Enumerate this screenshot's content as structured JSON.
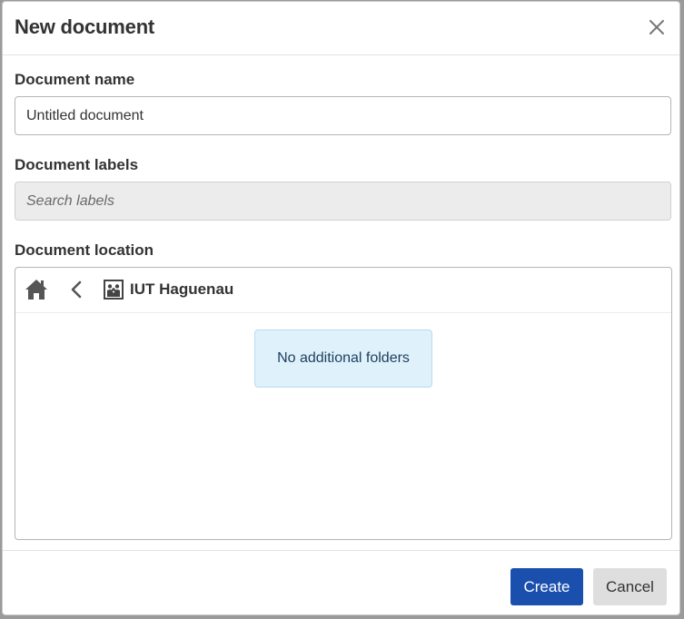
{
  "dialog": {
    "title": "New document"
  },
  "fields": {
    "name_label": "Document name",
    "name_value": "Untitled document",
    "labels_label": "Document labels",
    "labels_placeholder": "Search labels",
    "location_label": "Document location"
  },
  "location": {
    "breadcrumb": "IUT Haguenau",
    "empty_message": "No additional folders"
  },
  "footer": {
    "create_label": "Create",
    "cancel_label": "Cancel"
  },
  "colors": {
    "primary": "#1a4fae",
    "info_bg": "#dff1fb"
  }
}
